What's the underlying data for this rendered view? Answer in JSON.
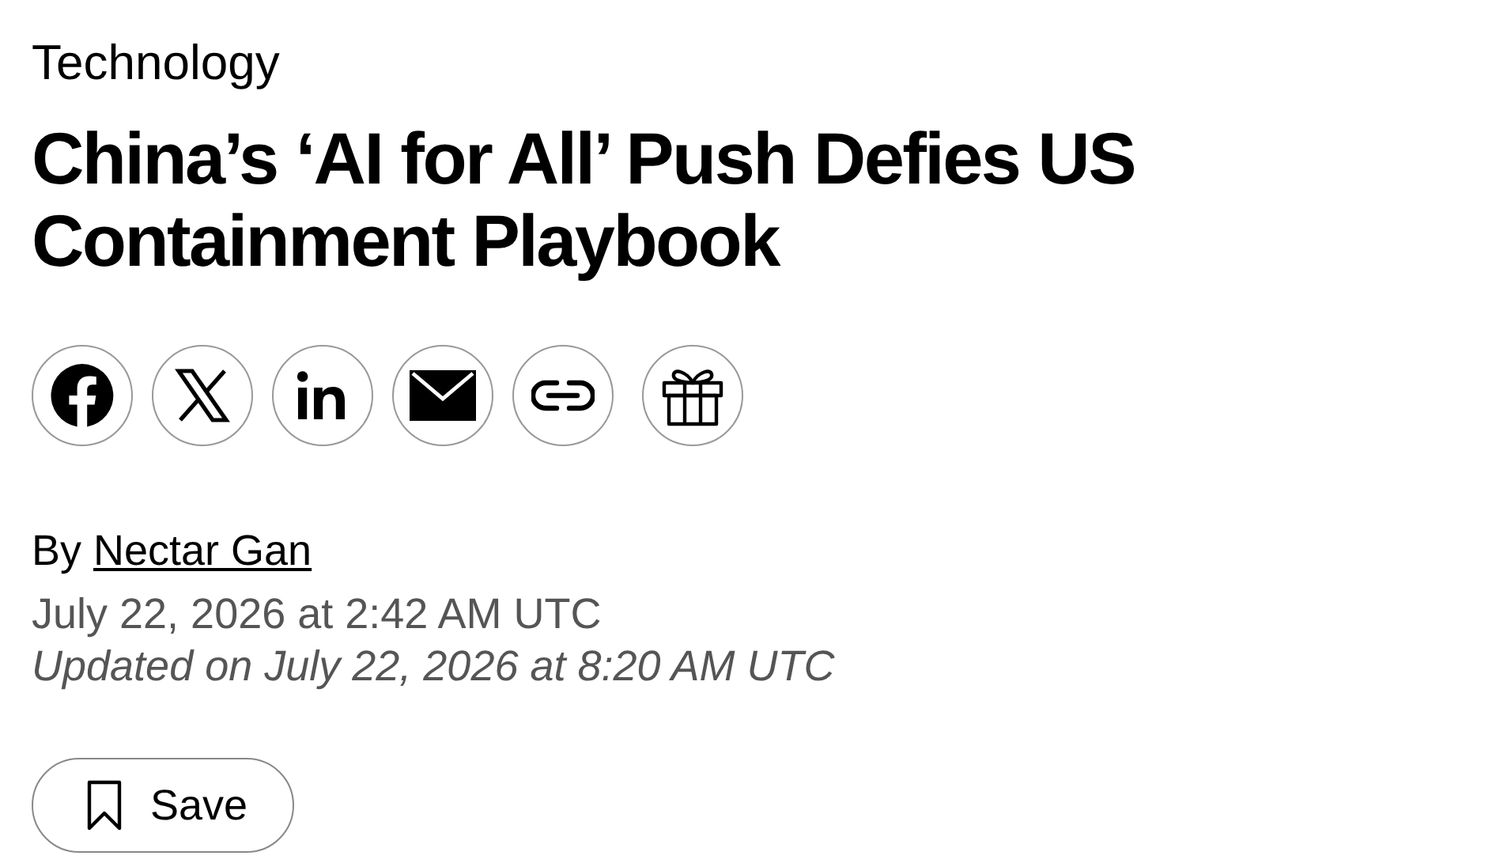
{
  "section": "Technology",
  "headline": "China’s ‘AI for All’ Push Defies US Containment Playbook",
  "share_buttons": [
    {
      "kind": "facebook"
    },
    {
      "kind": "x"
    },
    {
      "kind": "linkedin"
    },
    {
      "kind": "email"
    },
    {
      "kind": "link"
    },
    {
      "kind": "gift"
    }
  ],
  "byline": {
    "prefix": "By",
    "author": "Nectar Gan"
  },
  "published": "July 22, 2026 at 2:42 AM UTC",
  "updated": "Updated on July 22, 2026 at 8:20 AM UTC",
  "save_button": {
    "label": "Save"
  }
}
